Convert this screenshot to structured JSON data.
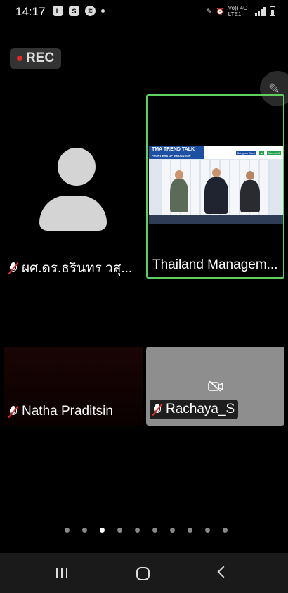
{
  "status_bar": {
    "time": "14:17",
    "left_icons": [
      "line-icon",
      "shopping-bag-icon",
      "spotify-icon"
    ],
    "network_top": "Vo)) 4G+",
    "network_bottom": "LTE1"
  },
  "recording": {
    "label": "REC",
    "dot_color": "#e02b2b"
  },
  "participants": [
    {
      "name": "ผศ.ดร.ธรินทร วสุ...",
      "muted": true,
      "video": false
    },
    {
      "name": "Thailand Managem...",
      "muted": false,
      "video": true,
      "active_speaker": true,
      "highlight_color": "#5fcf5f"
    },
    {
      "name": "Natha Praditsin",
      "muted": true,
      "video": true
    },
    {
      "name": "Rachaya_S",
      "muted": true,
      "video": false
    }
  ],
  "video_stream": {
    "banner": "TMA TREND TALK",
    "banner_sub": "FRONTIERS OF INNOVATION",
    "sponsor_1": "Bangkok Bank",
    "sponsor_2": "Microsoft"
  },
  "pager": {
    "page_count": 10,
    "active_index": 2
  },
  "navbar": {
    "items": [
      "recent-apps-icon",
      "home-icon",
      "back-icon"
    ]
  }
}
